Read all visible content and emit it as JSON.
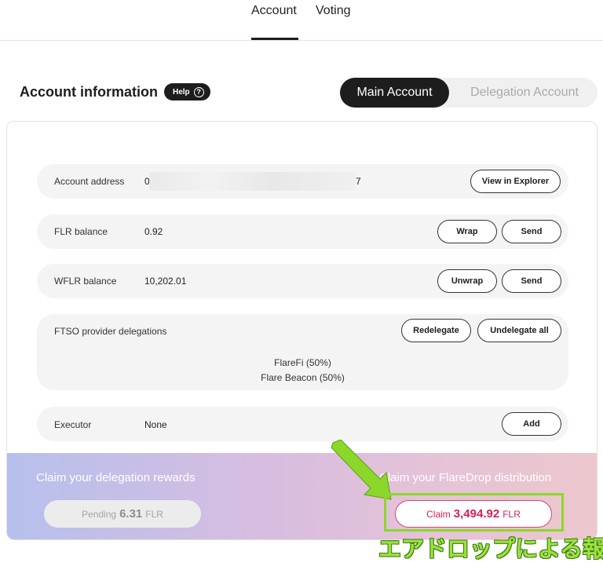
{
  "nav": {
    "tabs": [
      {
        "label": "Account"
      },
      {
        "label": "Voting"
      }
    ]
  },
  "header": {
    "title": "Account information",
    "help_label": "Help",
    "help_icon": "question-circle-icon",
    "toggle": {
      "main": "Main Account",
      "delegation": "Delegation Account"
    }
  },
  "rows": {
    "address": {
      "label": "Account address",
      "value_prefix": "0x3",
      "value_suffix": "7",
      "button": "View in Explorer"
    },
    "flr": {
      "label": "FLR balance",
      "value": "0.92",
      "buttons": [
        "Wrap",
        "Send"
      ]
    },
    "wflr": {
      "label": "WFLR balance",
      "value": "10,202.01",
      "buttons": [
        "Unwrap",
        "Send"
      ]
    },
    "ftso": {
      "label": "FTSO provider delegations",
      "buttons": [
        "Redelegate",
        "Undelegate all"
      ],
      "delegations": [
        "FlareFi (50%)",
        "Flare Beacon (50%)"
      ]
    },
    "executor": {
      "label": "Executor",
      "value": "None",
      "button": "Add"
    }
  },
  "claim": {
    "delegation_title": "Claim your delegation rewards",
    "pending_prefix": "Pending",
    "pending_amount": "6.31",
    "pending_unit": "FLR",
    "flaredrop_title": "Claim your FlareDrop distribution",
    "claim_prefix": "Claim",
    "claim_amount": "3,494.92",
    "claim_unit": "FLR"
  },
  "annotation": {
    "text": "エアドロップによる報酬",
    "color": "#8bd82a"
  },
  "colors": {
    "accent_dark": "#1d1d1d",
    "claim_pink": "#d81e5b",
    "panel_gradient_start": "#b6c0ec",
    "panel_gradient_end": "#ecc7cc"
  }
}
